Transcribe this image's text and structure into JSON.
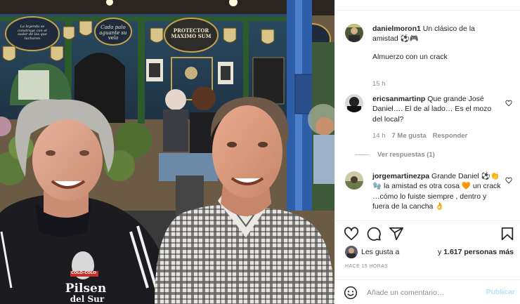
{
  "post": {
    "caption_user": "danielmoron1",
    "caption_text": "Un clásico de la amistad ⚽🎮",
    "caption_text2": "Almuerzo con un crack",
    "caption_time": "15 h"
  },
  "photo": {
    "plaque_left": "La leyenda se construye con el sudor de los que lucharon",
    "plaque_mid": "Cada palo aguante su vela",
    "plaque_right": "PROTECTOR MAXIMO SUM",
    "shirt_sponsor": "Pilsen",
    "shirt_sponsor2": "del Sur",
    "shirt_badge": "COLO-COLO"
  },
  "comments": [
    {
      "user": "ericsanmartinp",
      "text": "Que grande José Daniel…. El de al lado… Es el mozo del local?",
      "time": "14 h",
      "likes": "7 Me gusta",
      "reply": "Responder",
      "view_replies": "Ver respuestas (1)"
    },
    {
      "user": "jorgemartinezpa",
      "text": "Grande Daniel ⚽👏🧤 la amistad es otra cosa 🧡 un crack …cómo lo fuiste siempre , dentro y fuera de la cancha 👌"
    }
  ],
  "likes": {
    "prefix": "Les gusta a",
    "count_prefix": "y",
    "count": "1.617 personas más"
  },
  "timestamp": "Hace 15 horas",
  "add_comment": {
    "placeholder": "Añade un comentario…",
    "publish_label": "Publicar"
  },
  "colors": {
    "text": "#262626",
    "muted": "#8e8e8e",
    "publish": "#b2dffc",
    "divider": "#efefef"
  },
  "icons": [
    "heart-icon",
    "comment-icon",
    "share-icon",
    "bookmark-icon",
    "smile-icon",
    "heart-small-icon"
  ]
}
